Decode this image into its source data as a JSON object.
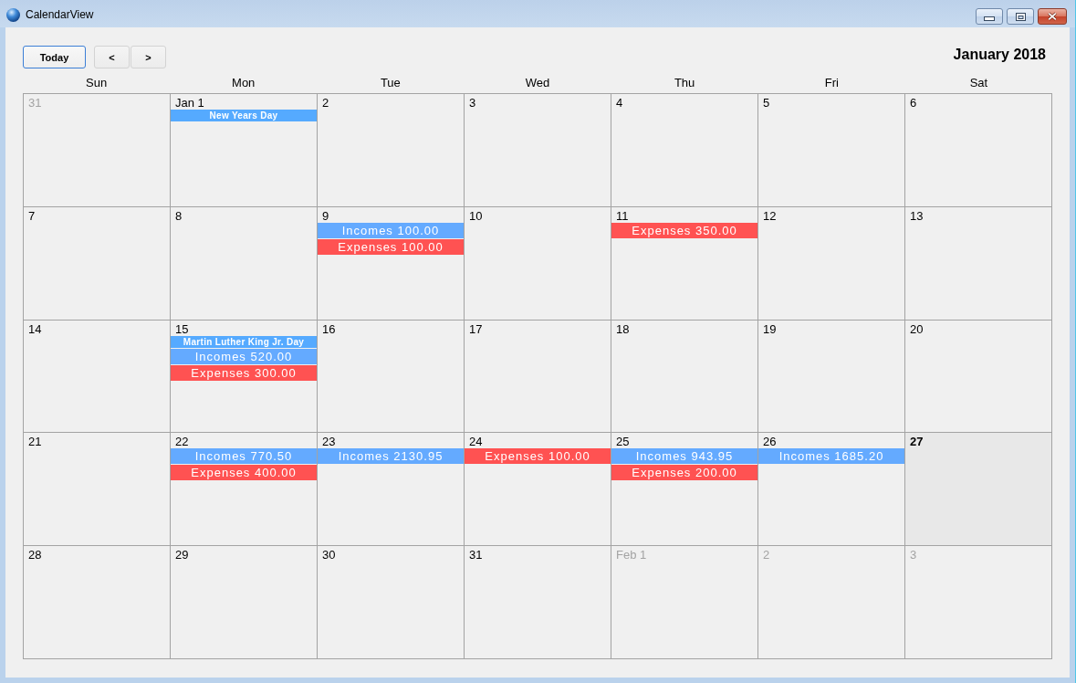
{
  "window": {
    "title": "CalendarView"
  },
  "toolbar": {
    "buttons": [
      {
        "label": "Today",
        "focused": true
      },
      {
        "label": "<",
        "focused": false
      },
      {
        "label": ">",
        "focused": false
      }
    ],
    "month_title": "January 2018"
  },
  "calendar": {
    "weekdays": [
      "Sun",
      "Mon",
      "Tue",
      "Wed",
      "Thu",
      "Fri",
      "Sat"
    ],
    "weeks": [
      [
        {
          "label": "31",
          "in_month": false,
          "today": false
        },
        {
          "label": "Jan 1",
          "in_month": true,
          "today": false,
          "events": [
            {
              "kind": "holiday",
              "text": "New Years Day"
            }
          ]
        },
        {
          "label": "2",
          "in_month": true,
          "today": false
        },
        {
          "label": "3",
          "in_month": true,
          "today": false
        },
        {
          "label": "4",
          "in_month": true,
          "today": false
        },
        {
          "label": "5",
          "in_month": true,
          "today": false
        },
        {
          "label": "6",
          "in_month": true,
          "today": false
        }
      ],
      [
        {
          "label": "7",
          "in_month": true,
          "today": false
        },
        {
          "label": "8",
          "in_month": true,
          "today": false
        },
        {
          "label": "9",
          "in_month": true,
          "today": false,
          "events": [
            {
              "kind": "income",
              "text": "Incomes 100.00"
            },
            {
              "kind": "expense",
              "text": "Expenses 100.00"
            }
          ]
        },
        {
          "label": "10",
          "in_month": true,
          "today": false
        },
        {
          "label": "11",
          "in_month": true,
          "today": false,
          "events": [
            {
              "kind": "expense",
              "text": "Expenses 350.00"
            }
          ]
        },
        {
          "label": "12",
          "in_month": true,
          "today": false
        },
        {
          "label": "13",
          "in_month": true,
          "today": false
        }
      ],
      [
        {
          "label": "14",
          "in_month": true,
          "today": false
        },
        {
          "label": "15",
          "in_month": true,
          "today": false,
          "events": [
            {
              "kind": "holiday",
              "text": "Martin Luther King Jr. Day"
            },
            {
              "kind": "income",
              "text": "Incomes 520.00"
            },
            {
              "kind": "expense",
              "text": "Expenses 300.00"
            }
          ]
        },
        {
          "label": "16",
          "in_month": true,
          "today": false
        },
        {
          "label": "17",
          "in_month": true,
          "today": false
        },
        {
          "label": "18",
          "in_month": true,
          "today": false
        },
        {
          "label": "19",
          "in_month": true,
          "today": false
        },
        {
          "label": "20",
          "in_month": true,
          "today": false
        }
      ],
      [
        {
          "label": "21",
          "in_month": true,
          "today": false
        },
        {
          "label": "22",
          "in_month": true,
          "today": false,
          "events": [
            {
              "kind": "income",
              "text": "Incomes 770.50"
            },
            {
              "kind": "expense",
              "text": "Expenses 400.00"
            }
          ]
        },
        {
          "label": "23",
          "in_month": true,
          "today": false,
          "events": [
            {
              "kind": "income",
              "text": "Incomes 2130.95"
            }
          ]
        },
        {
          "label": "24",
          "in_month": true,
          "today": false,
          "events": [
            {
              "kind": "expense",
              "text": "Expenses 100.00"
            }
          ]
        },
        {
          "label": "25",
          "in_month": true,
          "today": false,
          "events": [
            {
              "kind": "income",
              "text": "Incomes 943.95"
            },
            {
              "kind": "expense",
              "text": "Expenses 200.00"
            }
          ]
        },
        {
          "label": "26",
          "in_month": true,
          "today": false,
          "events": [
            {
              "kind": "income",
              "text": "Incomes 1685.20"
            }
          ]
        },
        {
          "label": "27",
          "in_month": true,
          "today": true
        }
      ],
      [
        {
          "label": "28",
          "in_month": true,
          "today": false
        },
        {
          "label": "29",
          "in_month": true,
          "today": false
        },
        {
          "label": "30",
          "in_month": true,
          "today": false
        },
        {
          "label": "31",
          "in_month": true,
          "today": false
        },
        {
          "label": "Feb 1",
          "in_month": false,
          "today": false
        },
        {
          "label": "2",
          "in_month": false,
          "today": false
        },
        {
          "label": "3",
          "in_month": false,
          "today": false
        }
      ]
    ]
  }
}
